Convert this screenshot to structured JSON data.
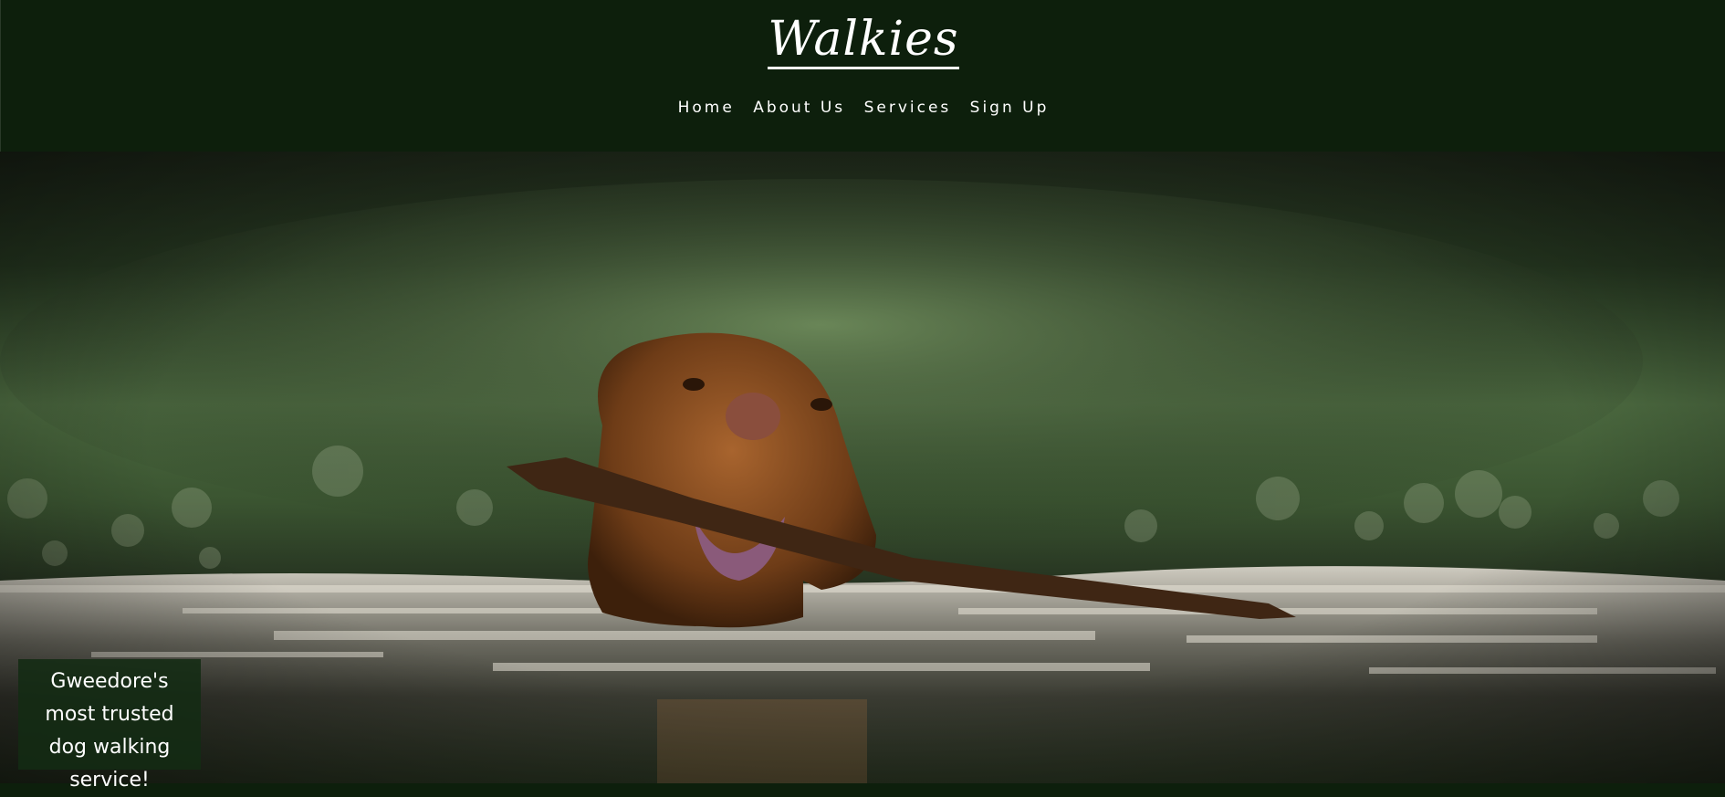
{
  "header": {
    "title": "Walkies",
    "nav": {
      "home": "Home",
      "about": "About Us",
      "services": "Services",
      "signup": "Sign Up"
    }
  },
  "hero": {
    "image_description_icon": "dog-swimming-with-stick-photo",
    "tagline": "Gweedore's most trusted dog walking service!"
  },
  "colors": {
    "header_bg": "#0d1f0c",
    "tagline_bg": "#132b13",
    "text": "#ffffff"
  }
}
